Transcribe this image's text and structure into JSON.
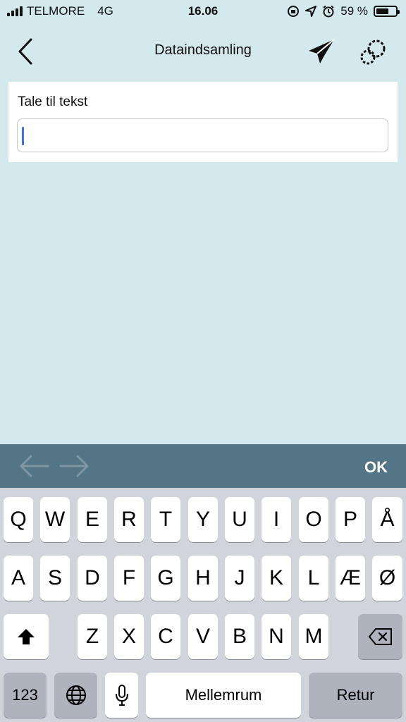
{
  "status_bar": {
    "carrier": "TELMORE",
    "network": "4G",
    "time": "16.06",
    "battery": "59 %"
  },
  "nav": {
    "title": "Dataindsamling"
  },
  "form": {
    "field_label": "Tale til tekst",
    "field_value": ""
  },
  "accessory": {
    "ok_label": "OK"
  },
  "keyboard": {
    "row1": [
      "Q",
      "W",
      "E",
      "R",
      "T",
      "Y",
      "U",
      "I",
      "O",
      "P",
      "Å"
    ],
    "row2": [
      "A",
      "S",
      "D",
      "F",
      "G",
      "H",
      "J",
      "K",
      "L",
      "Æ",
      "Ø"
    ],
    "row3": [
      "Z",
      "X",
      "C",
      "V",
      "B",
      "N",
      "M"
    ],
    "numbers_label": "123",
    "space_label": "Mellemrum",
    "return_label": "Retur"
  },
  "icons": {
    "back": "chevron-left-icon",
    "send": "paper-plane-icon",
    "settings": "gear-icon",
    "prev": "arrow-left-icon",
    "next": "arrow-right-icon",
    "shift": "shift-icon",
    "delete": "backspace-icon",
    "globe": "globe-icon",
    "mic": "microphone-icon"
  },
  "colors": {
    "background": "#d3e9ec",
    "accessory_bar": "#537586",
    "caret": "#3b6ef7",
    "keyboard_bg": "#d1d4da"
  }
}
